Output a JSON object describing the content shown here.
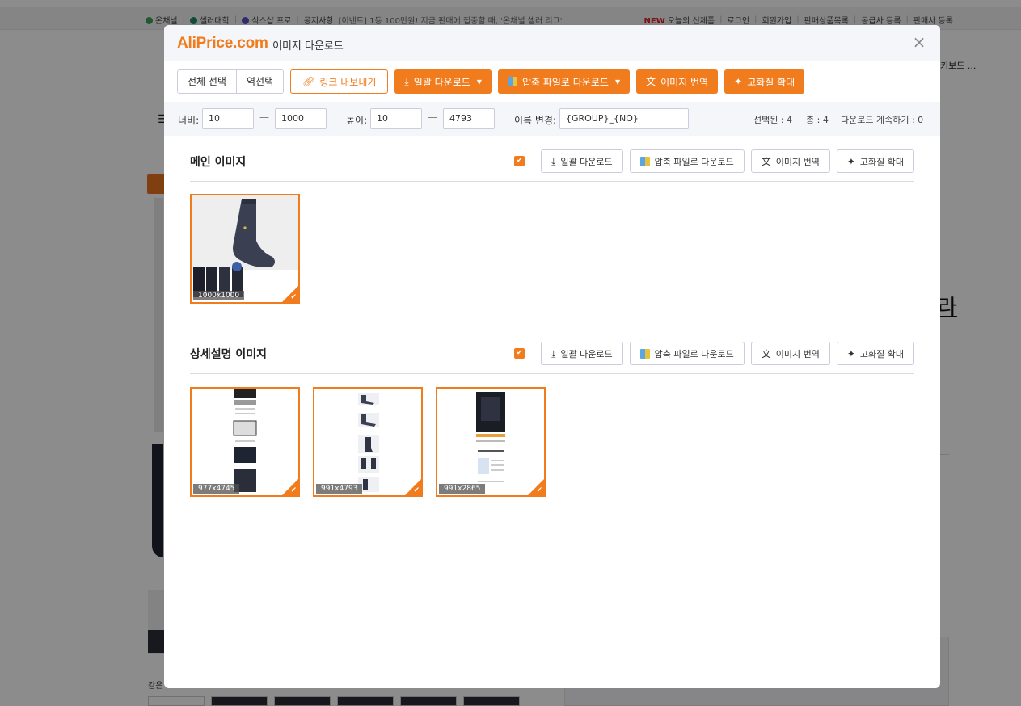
{
  "background_page": {
    "nav_left": [
      "온채널",
      "셀러대학",
      "식스샵 프로",
      "공지사항",
      "[이벤트] 1등 100만원! 지금 판매에 집중할 때, '온채널 셀러 리그'"
    ],
    "nav_right_new": "NEW",
    "nav_right": [
      "오늘의 신제품",
      "로그인",
      "회원가입",
      "판매상품목록",
      "공급사 등록",
      "판매사 등록"
    ],
    "keyboard_text": "키보드 ...",
    "big_char": "라",
    "related_label": "같은"
  },
  "modal": {
    "logo": "AliPrice.com",
    "title": "이미지 다운로드",
    "close_icon": "×"
  },
  "toolbar": {
    "select_all": "전체 선택",
    "invert_select": "역선택",
    "export_links": "링크 내보내기",
    "bulk_download": "일괄 다운로드",
    "zip_download": "압축 파일로 다운로드",
    "translate": "이미지 번역",
    "upscale": "고화질 확대",
    "accent_color": "#f07c1e"
  },
  "filter": {
    "width_label": "너비:",
    "width_min": "10",
    "width_max": "1000",
    "height_label": "높이:",
    "height_min": "10",
    "height_max": "4793",
    "range_dash": "—",
    "rename_label": "이름 변경:",
    "rename_value": "{GROUP}_{NO}",
    "selected_text": "선택된 : 4",
    "total_text": "총 : 4",
    "continue_text": "다운로드 계속하기 : 0"
  },
  "sections": [
    {
      "title": "메인 이미지",
      "checked": true,
      "bulk_download": "일괄 다운로드",
      "zip_download": "압축 파일로 다운로드",
      "translate": "이미지 번역",
      "upscale": "고화질 확대",
      "images": [
        {
          "dims": "1000x1000",
          "kind": "main-sock"
        }
      ]
    },
    {
      "title": "상세설명 이미지",
      "checked": true,
      "bulk_download": "일괄 다운로드",
      "zip_download": "압축 파일로 다운로드",
      "translate": "이미지 번역",
      "upscale": "고화질 확대",
      "images": [
        {
          "dims": "977x4745",
          "kind": "detail-1"
        },
        {
          "dims": "991x4793",
          "kind": "detail-2"
        },
        {
          "dims": "991x2865",
          "kind": "detail-3"
        }
      ]
    }
  ]
}
